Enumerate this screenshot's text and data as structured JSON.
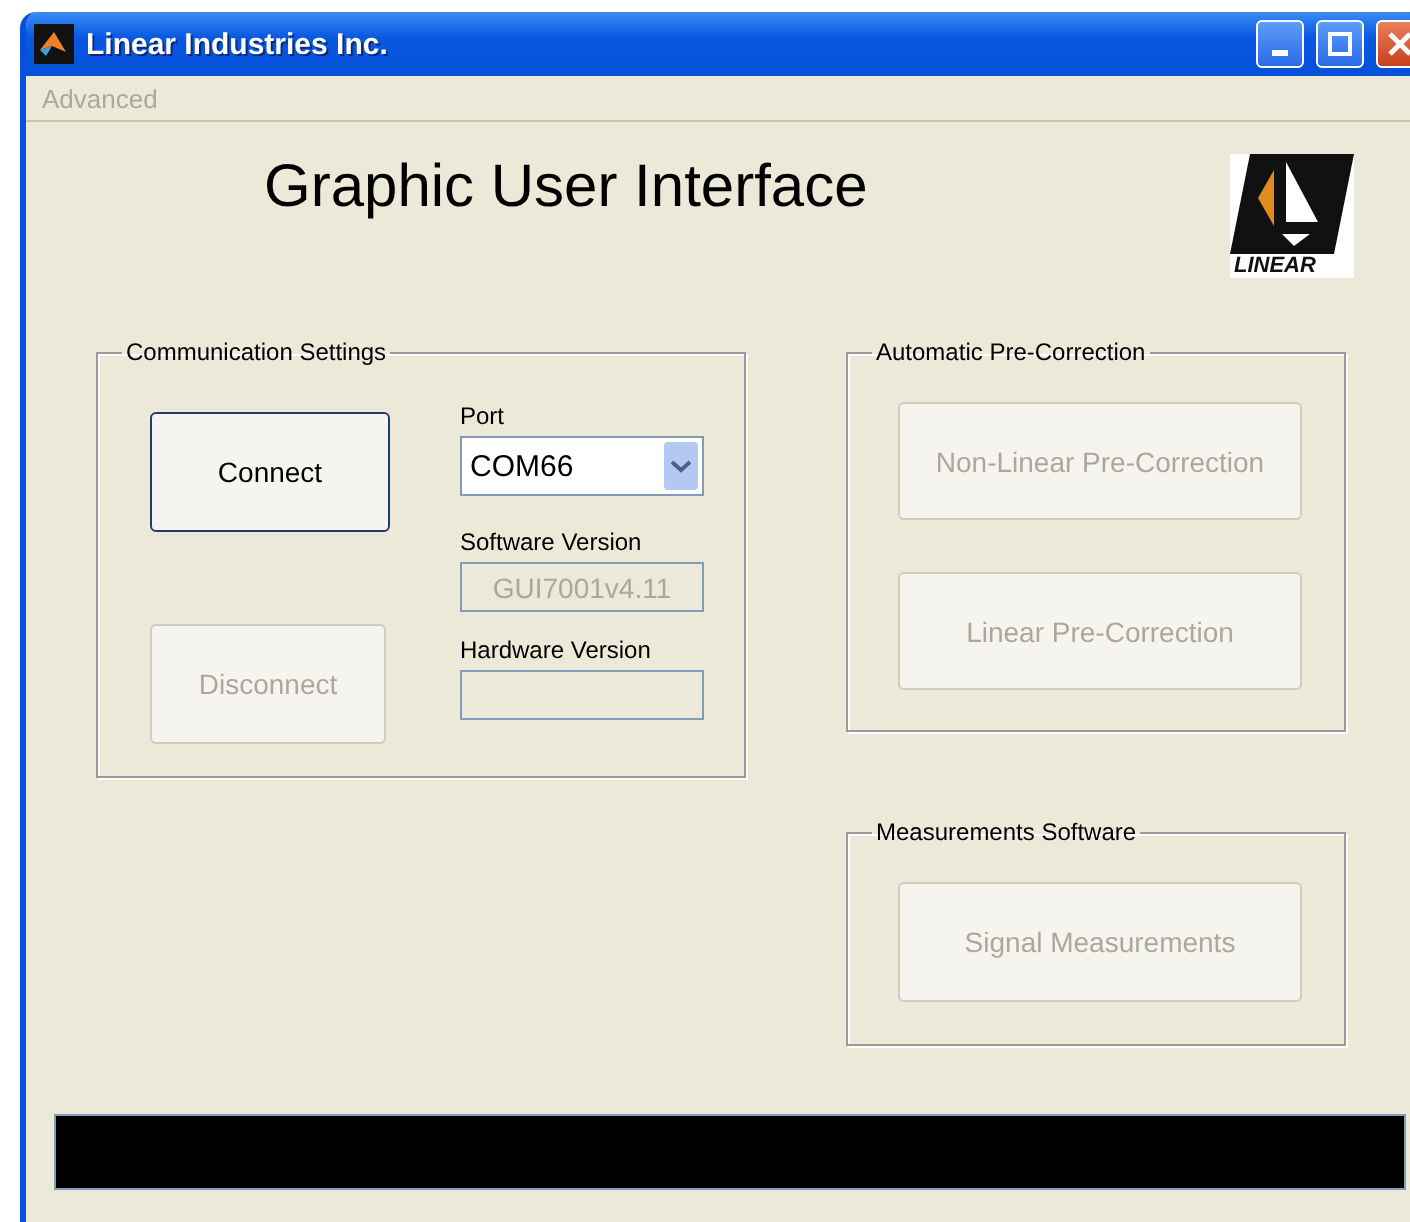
{
  "window": {
    "title": "Linear Industries Inc."
  },
  "menu": [
    {
      "label": "Advanced",
      "disabled": true
    }
  ],
  "header": {
    "title": "Graphic User Interface",
    "logo_text": "LINEAR"
  },
  "communication_settings": {
    "title": "Communication Settings",
    "connect_button": {
      "label": "Connect",
      "disabled": false
    },
    "disconnect_button": {
      "label": "Disconnect",
      "disabled": true
    },
    "port": {
      "label": "Port",
      "value": "COM66"
    },
    "software_version": {
      "label": "Software Version",
      "value": "GUI7001v4.11",
      "disabled": true
    },
    "hardware_version": {
      "label": "Hardware Version"
    }
  },
  "automatic_pre_correction": {
    "title": "Automatic Pre-Correction",
    "buttons": [
      {
        "label": "Non-Linear Pre-Correction",
        "disabled": true
      },
      {
        "label": "Linear Pre-Correction",
        "disabled": true
      }
    ]
  },
  "measurements_software": {
    "title": "Measurements Software",
    "buttons": [
      {
        "label": "Signal Measurements",
        "disabled": true
      }
    ]
  }
}
